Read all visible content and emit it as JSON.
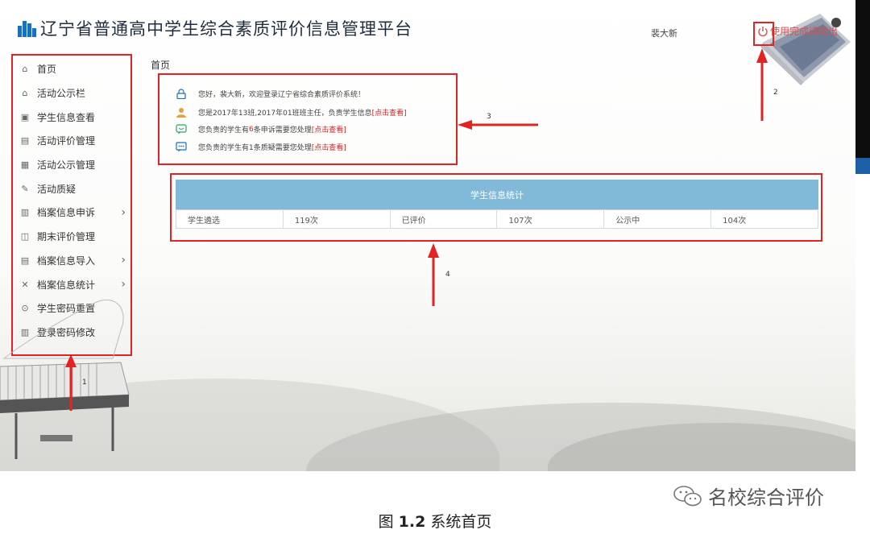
{
  "header": {
    "title": "辽宁省普通高中学生综合素质评价信息管理平台",
    "user_name": "裴大新",
    "logout_label": "使用完成请退出"
  },
  "sidebar": {
    "items": [
      {
        "label": "首页",
        "icon": "home-icon",
        "has_submenu": false
      },
      {
        "label": "活动公示栏",
        "icon": "bulletin-icon",
        "has_submenu": false
      },
      {
        "label": "学生信息查看",
        "icon": "student-info-icon",
        "has_submenu": false
      },
      {
        "label": "活动评价管理",
        "icon": "evaluation-icon",
        "has_submenu": false
      },
      {
        "label": "活动公示管理",
        "icon": "grid-icon",
        "has_submenu": false
      },
      {
        "label": "活动质疑",
        "icon": "edit-icon",
        "has_submenu": false
      },
      {
        "label": "档案信息申诉",
        "icon": "appeal-icon",
        "has_submenu": true
      },
      {
        "label": "期末评价管理",
        "icon": "term-eval-icon",
        "has_submenu": false
      },
      {
        "label": "档案信息导入",
        "icon": "import-icon",
        "has_submenu": true
      },
      {
        "label": "档案信息统计",
        "icon": "statistics-icon",
        "has_submenu": true
      },
      {
        "label": "学生密码重置",
        "icon": "lock-icon",
        "has_submenu": false
      },
      {
        "label": "登录密码修改",
        "icon": "bar-chart-icon",
        "has_submenu": false
      }
    ]
  },
  "breadcrumb": "首页",
  "notices": {
    "welcome": "您好，裴大新，欢迎登录辽宁省综合素质评价系统！",
    "role": {
      "text": "您是2017年13班,2017年01班班主任，负责学生信息",
      "link": "[点击查看]"
    },
    "appeals": {
      "pre": "您负责的学生有",
      "count": "6",
      "post": "条申诉需要您处理",
      "link": "[点击查看]"
    },
    "doubts": {
      "text": "您负责的学生有1条质疑需要您处理",
      "link": "[点击查看]"
    }
  },
  "stats": {
    "title": "学生信息统计",
    "cells": [
      "学生遴选",
      "119次",
      "已评价",
      "107次",
      "公示中",
      "104次"
    ]
  },
  "annotations": [
    "1",
    "2",
    "3",
    "4"
  ],
  "watermark": "名校综合评价",
  "caption": {
    "prefix": "图",
    "number": "1.2",
    "text": "系统首页"
  },
  "colors": {
    "annotation_red": "#e32222",
    "header_blue": "#81bad8",
    "link_red": "#d62020",
    "icon_blue": "#1c6fbf"
  }
}
